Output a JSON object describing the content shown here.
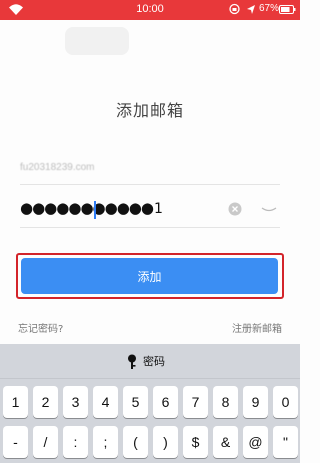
{
  "status_bar": {
    "time": "10:00",
    "battery_percent": "67%",
    "background_color": "#e8383a"
  },
  "page": {
    "title": "添加邮箱"
  },
  "email_field": {
    "value": "fu20318239.com"
  },
  "password_field": {
    "value": "●●●●●●●●●●●",
    "cursor_char": "1"
  },
  "buttons": {
    "add_label": "添加",
    "add_color": "#3b8ef3"
  },
  "links": {
    "forgot_password": "忘记密码?",
    "register_email": "注册新邮箱"
  },
  "keyboard": {
    "bar_label": "密码",
    "row1": [
      "1",
      "2",
      "3",
      "4",
      "5",
      "6",
      "7",
      "8",
      "9",
      "0"
    ],
    "row2": [
      "-",
      "/",
      ":",
      ";",
      "(",
      ")",
      "$",
      "&",
      "@",
      "\""
    ]
  }
}
